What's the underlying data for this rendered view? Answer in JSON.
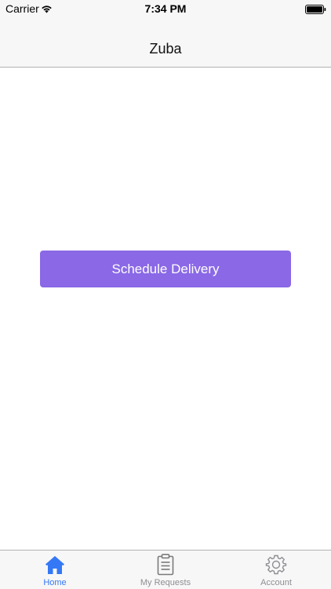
{
  "status_bar": {
    "carrier": "Carrier",
    "time": "7:34 PM",
    "wifi_icon": "wifi-icon",
    "battery_icon": "battery-icon"
  },
  "nav": {
    "title": "Zuba"
  },
  "main": {
    "schedule_button": "Schedule Delivery",
    "button_color": "#8a68e6"
  },
  "tabbar": {
    "active_color": "#3478f6",
    "inactive_color": "#8e8e93",
    "tabs": [
      {
        "label": "Home",
        "icon": "home-icon",
        "active": true
      },
      {
        "label": "My Requests",
        "icon": "clipboard-icon",
        "active": false
      },
      {
        "label": "Account",
        "icon": "gear-icon",
        "active": false
      }
    ]
  }
}
